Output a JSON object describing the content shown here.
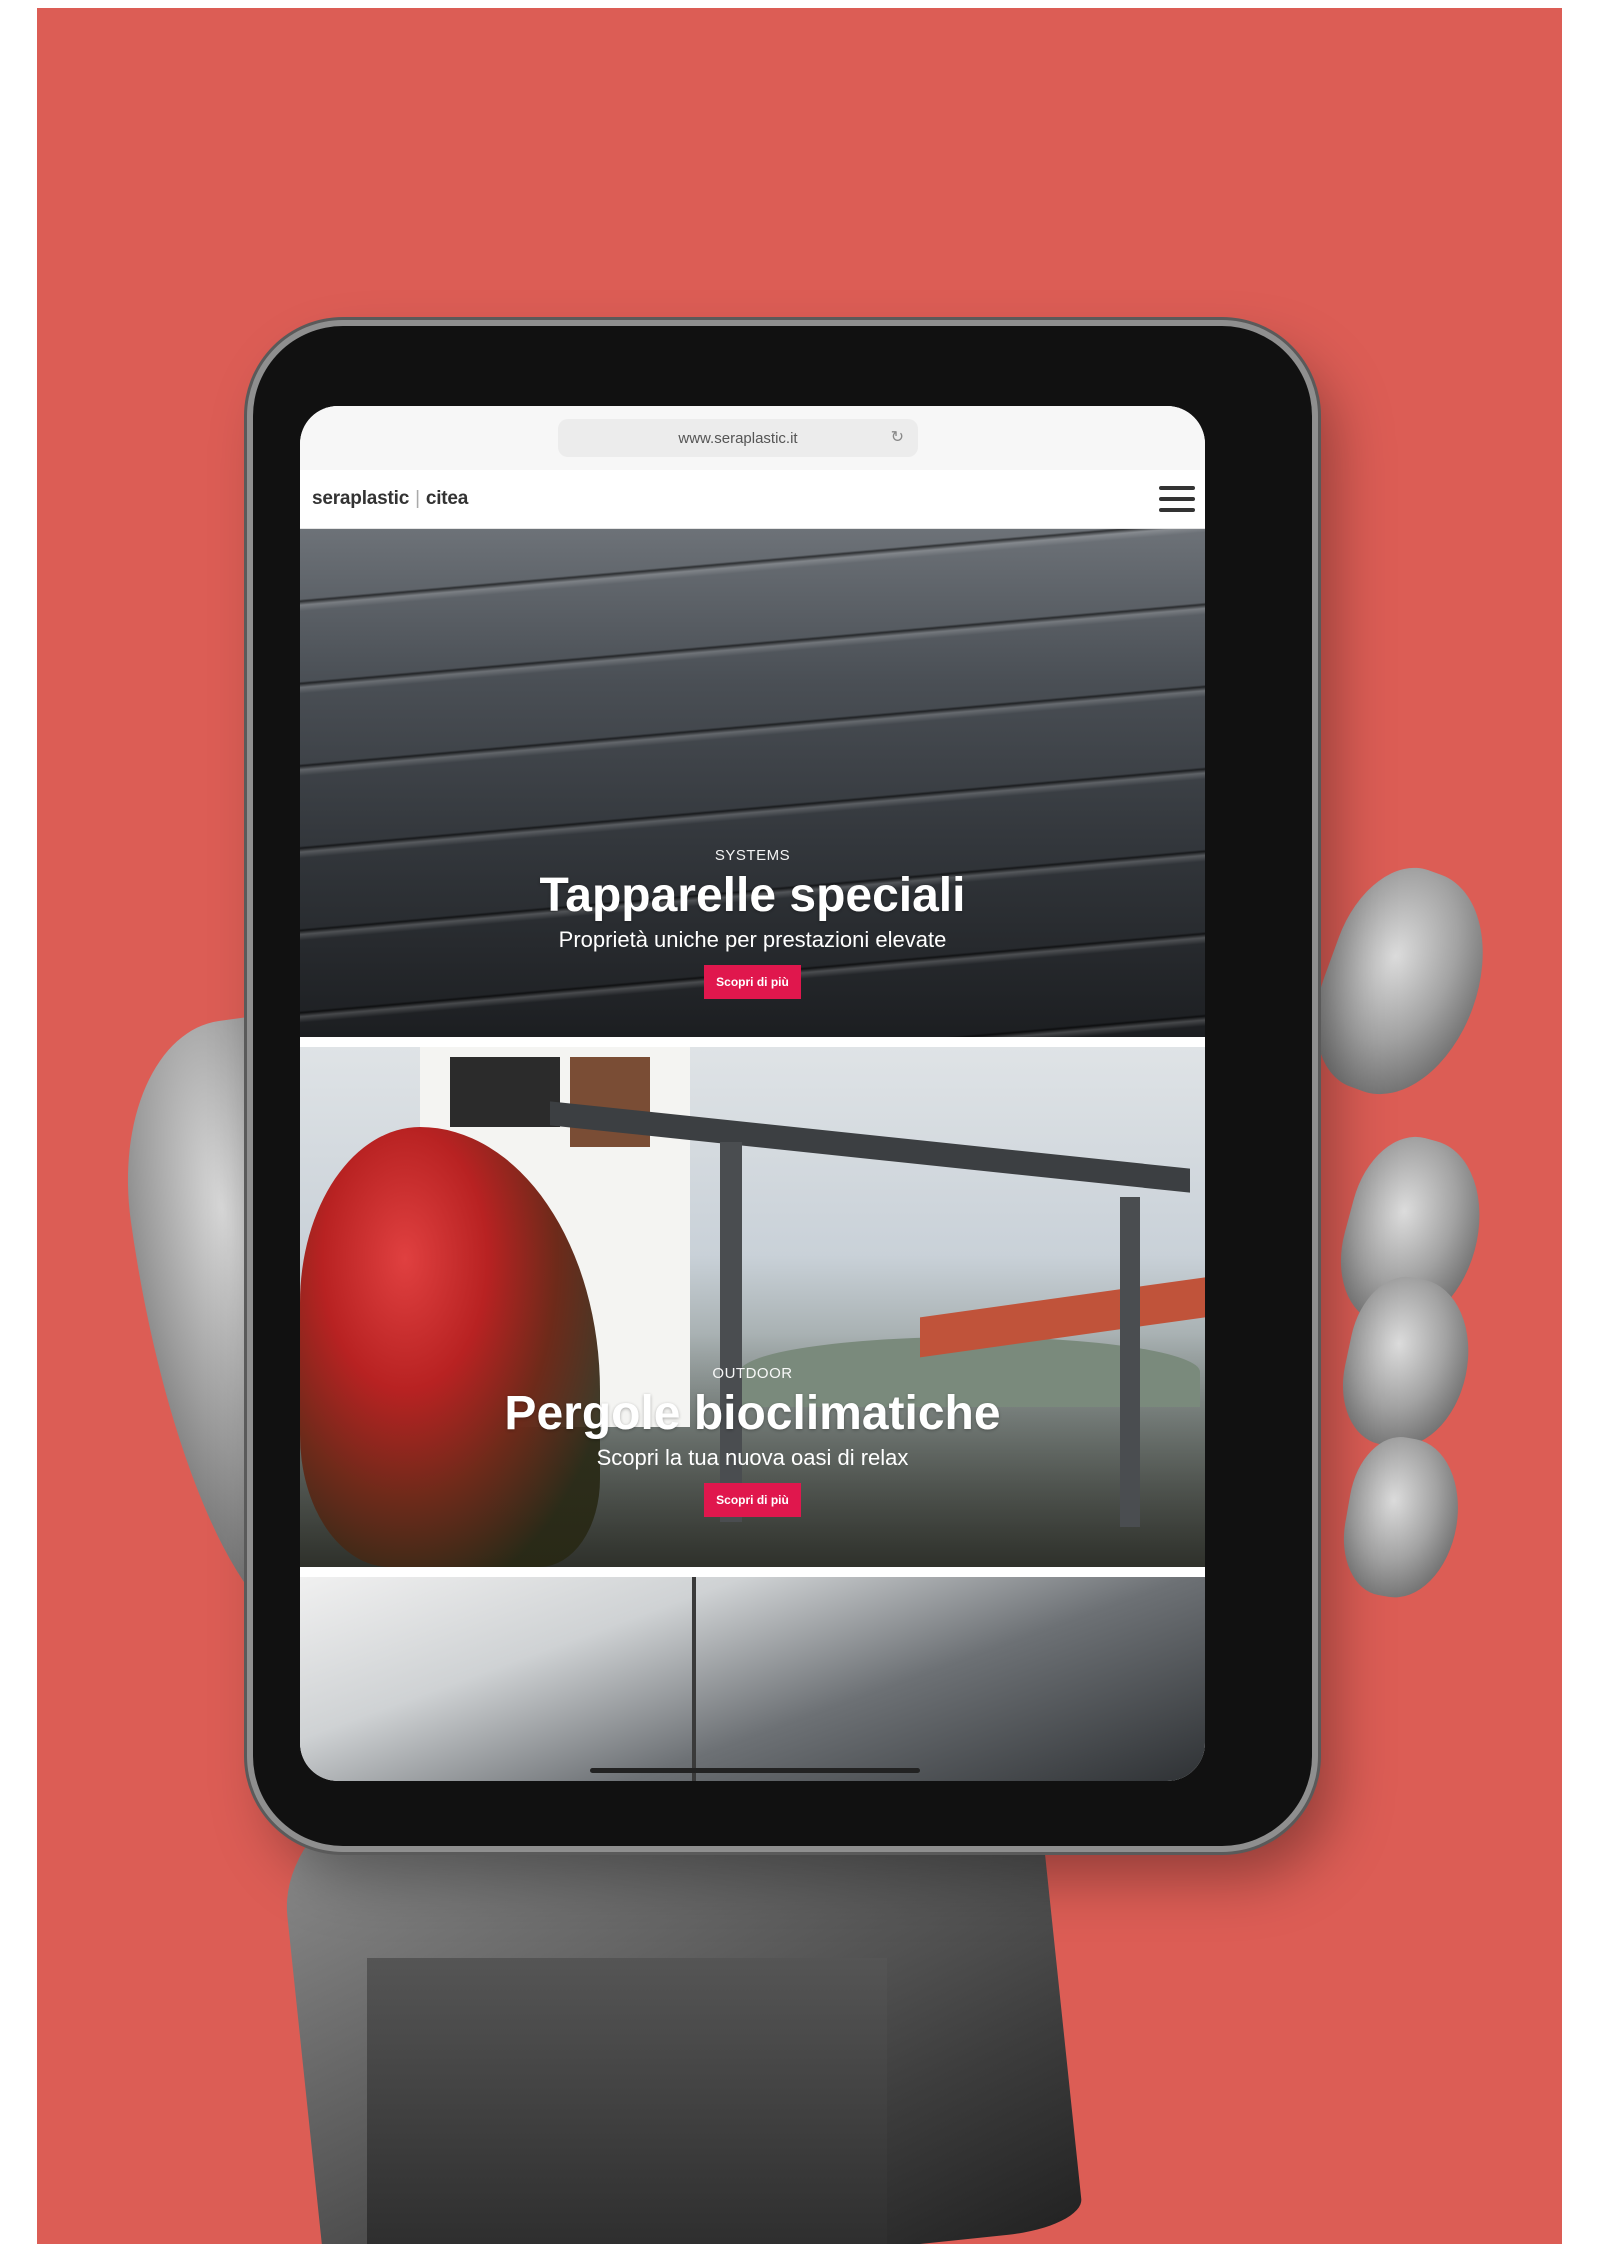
{
  "browser": {
    "url": "www.seraplastic.it",
    "reload_icon": "reload-icon"
  },
  "site": {
    "logo_primary": "seraplastic",
    "logo_separator": "|",
    "logo_secondary": "citea",
    "menu_icon": "hamburger-menu-icon"
  },
  "sections": [
    {
      "eyebrow": "SYSTEMS",
      "title": "Tapparelle speciali",
      "subtitle": "Proprietà uniche per prestazioni elevate",
      "cta": "Scopri di più"
    },
    {
      "eyebrow": "OUTDOOR",
      "title": "Pergole bioclimatiche",
      "subtitle": "Scopri la tua nuova oasi di relax",
      "cta": "Scopri di più"
    }
  ],
  "colors": {
    "background": "#dc5d55",
    "cta": "#e0174d"
  }
}
